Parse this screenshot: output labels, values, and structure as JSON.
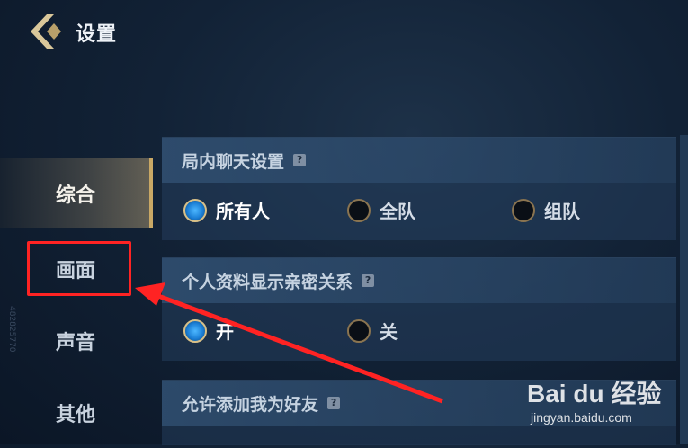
{
  "header": {
    "title": "设置"
  },
  "sidebar": {
    "items": [
      {
        "label": "综合",
        "active": true
      },
      {
        "label": "画面",
        "active": false
      },
      {
        "label": "声音",
        "active": false
      },
      {
        "label": "其他",
        "active": false
      }
    ],
    "vertical_text": "482825770"
  },
  "sections": [
    {
      "title": "局内聊天设置",
      "options": [
        {
          "label": "所有人",
          "selected": true
        },
        {
          "label": "全队",
          "selected": false
        },
        {
          "label": "组队",
          "selected": false
        }
      ]
    },
    {
      "title": "个人资料显示亲密关系",
      "options": [
        {
          "label": "开",
          "selected": true
        },
        {
          "label": "关",
          "selected": false
        }
      ]
    },
    {
      "title": "允许添加我为好友",
      "options": []
    }
  ],
  "help_glyph": "?",
  "watermark": {
    "logo": "Bai du 经验",
    "url": "jingyan.baidu.com"
  },
  "colors": {
    "accent_gold": "#c9a865",
    "highlight_red": "#ff2323",
    "radio_on": "#1b7fd6"
  }
}
